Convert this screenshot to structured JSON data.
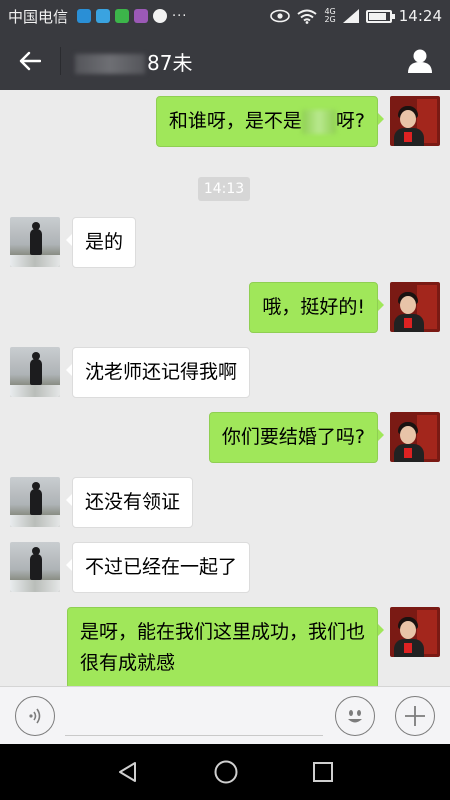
{
  "status_bar": {
    "carrier": "中国电信",
    "network_top": "4G",
    "network_bottom": "2G",
    "time": "14:24",
    "battery_level": 0.85,
    "overflow": "···"
  },
  "header": {
    "title_visible_suffix": "87未",
    "back_icon": "arrow-left-icon",
    "profile_icon": "person-icon"
  },
  "messages": [
    {
      "side": "out",
      "text_before": "和谁呀，是不是",
      "text_after": "呀?"
    },
    {
      "side": "time",
      "text": "14:13"
    },
    {
      "side": "in",
      "text": "是的"
    },
    {
      "side": "out",
      "text": "哦，挺好的!"
    },
    {
      "side": "in",
      "text": "沈老师还记得我啊"
    },
    {
      "side": "out",
      "text": "你们要结婚了吗?"
    },
    {
      "side": "in",
      "text": "还没有领证"
    },
    {
      "side": "in",
      "text": "不过已经在一起了"
    },
    {
      "side": "out",
      "text": "是呀，能在我们这里成功，我们也\n很有成就感"
    }
  ],
  "input_bar": {
    "voice_icon": "voice-icon",
    "emoji_icon": "smiley-icon",
    "plus_icon": "plus-icon"
  },
  "nav_bar": {
    "back_icon": "triangle-back-icon",
    "home_icon": "circle-home-icon",
    "recents_icon": "square-recents-icon"
  },
  "colors": {
    "header_bg": "#393a3f",
    "chat_bg": "#ebebeb",
    "outgoing_bubble": "#a0e75a",
    "incoming_bubble": "#ffffff"
  }
}
